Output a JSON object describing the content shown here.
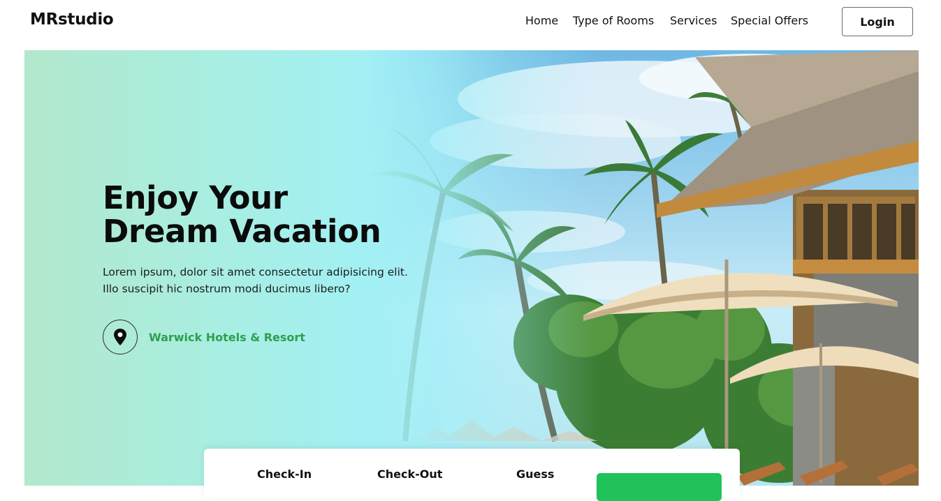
{
  "brand": {
    "logo": "MRstudio"
  },
  "nav": {
    "items": [
      {
        "label": "Home"
      },
      {
        "label": "Type of Rooms"
      },
      {
        "label": "Services"
      },
      {
        "label": "Special Offers"
      }
    ],
    "login_label": "Login"
  },
  "hero": {
    "title_line1": "Enjoy Your",
    "title_line2": "Dream Vacation",
    "description": "Lorem ipsum, dolor sit amet consectetur adipisicing elit. Illo suscipit hic nostrum modi ducimus libero?",
    "location": {
      "icon": "map-pin-icon",
      "name": "Warwick Hotels & Resort"
    }
  },
  "booking": {
    "fields": [
      {
        "label": "Check-In"
      },
      {
        "label": "Check-Out"
      },
      {
        "label": "Guess"
      }
    ]
  },
  "colors": {
    "accent_green": "#21c25a",
    "location_text": "#2f9e4f",
    "hero_gradient_left": "#b2e8cc",
    "hero_gradient_mid": "#a2f0f4"
  }
}
